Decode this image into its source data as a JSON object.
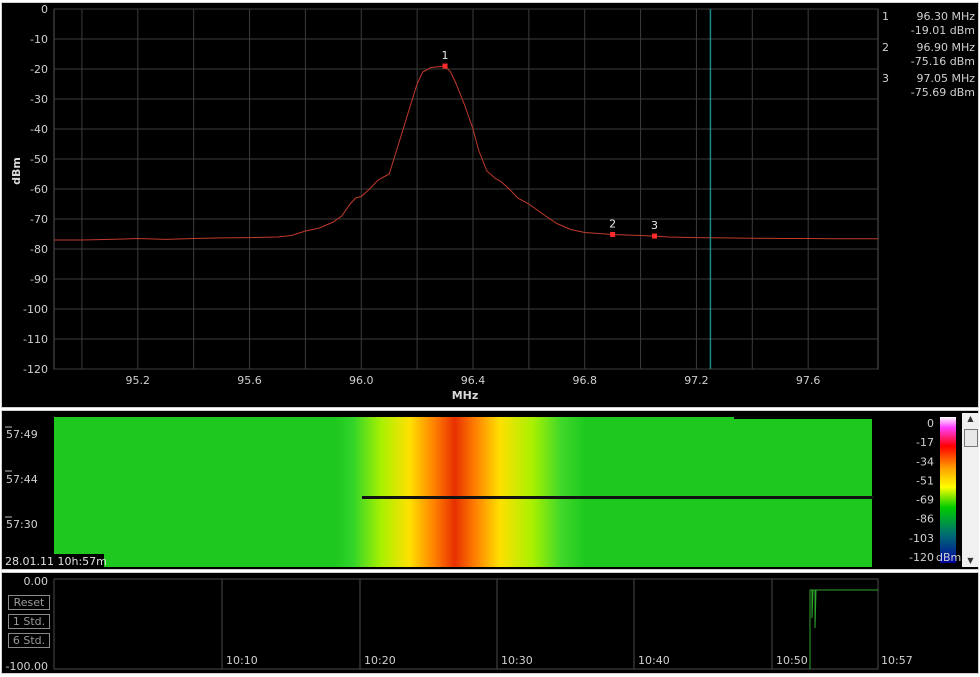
{
  "chart_data": [
    {
      "type": "line",
      "xlabel": "MHz",
      "ylabel": "dBm",
      "xlim": [
        94.9,
        97.85
      ],
      "ylim": [
        -120,
        0
      ],
      "grid": true,
      "x_ticks": [
        "95.2",
        "95.6",
        "96.0",
        "96.4",
        "96.8",
        "97.2",
        "97.6"
      ],
      "y_ticks": [
        "0",
        "-10",
        "-20",
        "-30",
        "-40",
        "-50",
        "-60",
        "-70",
        "-80",
        "-90",
        "-100",
        "-110",
        "-120"
      ],
      "series": [
        {
          "x": [
            94.9,
            95.0,
            95.1,
            95.2,
            95.3,
            95.4,
            95.5,
            95.6,
            95.7,
            95.75,
            95.8,
            95.85,
            95.9,
            95.93,
            95.96,
            95.98,
            96.0,
            96.03,
            96.06,
            96.08,
            96.1,
            96.12,
            96.15,
            96.18,
            96.2,
            96.22,
            96.25,
            96.28,
            96.3,
            96.32,
            96.34,
            96.37,
            96.4,
            96.42,
            96.45,
            96.48,
            96.5,
            96.53,
            96.56,
            96.6,
            96.63,
            96.66,
            96.7,
            96.75,
            96.8,
            96.9,
            97.0,
            97.05,
            97.1,
            97.2,
            97.3,
            97.4,
            97.5,
            97.6,
            97.7,
            97.85
          ],
          "y": [
            -77,
            -77,
            -76.8,
            -76.5,
            -76.8,
            -76.5,
            -76.3,
            -76.2,
            -76,
            -75.5,
            -74,
            -73,
            -71,
            -69,
            -65,
            -63,
            -62.5,
            -60,
            -57,
            -56,
            -55,
            -49,
            -40,
            -31,
            -25,
            -21,
            -19.5,
            -19.2,
            -19.01,
            -21,
            -25,
            -32,
            -40,
            -47,
            -54,
            -56.5,
            -57.5,
            -60,
            -63,
            -65,
            -67,
            -69,
            -71.5,
            -73.5,
            -74.5,
            -75.16,
            -75.5,
            -75.69,
            -76,
            -76.2,
            -76.3,
            -76.4,
            -76.5,
            -76.5,
            -76.6,
            -76.6
          ]
        }
      ],
      "markers": [
        {
          "id": "1",
          "freq": "96.30 MHz",
          "level": "-19.01 dBm",
          "x": 96.3,
          "y": -19.01
        },
        {
          "id": "2",
          "freq": "96.90 MHz",
          "level": "-75.16 dBm",
          "x": 96.9,
          "y": -75.16
        },
        {
          "id": "3",
          "freq": "97.05 MHz",
          "level": "-75.69 dBm",
          "x": 97.05,
          "y": -75.69
        }
      ],
      "vertical_line_x": 97.25
    },
    {
      "type": "heatmap",
      "time_labels": [
        "57:49",
        "57:44",
        "57:30"
      ],
      "timestamp": "28.01.11 10h:57m",
      "colorbar_ticks": [
        "0",
        "-17",
        "-34",
        "-51",
        "-69",
        "-86",
        "-103",
        "-120"
      ],
      "colorbar_unit": "dBm",
      "colorbar_colors": [
        "#ffffff",
        "#ff40ff",
        "#ff0000",
        "#ffa000",
        "#ffff00",
        "#00cc00",
        "#007070",
        "#0000a0"
      ]
    },
    {
      "type": "line",
      "y_top_label": "0.00",
      "y_bottom_label": "-100.00",
      "x_ticks": [
        "10:10",
        "10:20",
        "10:30",
        "10:40",
        "10:50",
        "10:57"
      ]
    }
  ],
  "controls": {
    "reset": "Reset",
    "one_std": "1 Std.",
    "six_std": "6 Std."
  },
  "colors": {
    "trace": "#c0392b",
    "marker": "#ff2a2a",
    "vline": "#1a8a8a",
    "history_trace": "#2ea62e",
    "grid": "#3c3c3c"
  }
}
